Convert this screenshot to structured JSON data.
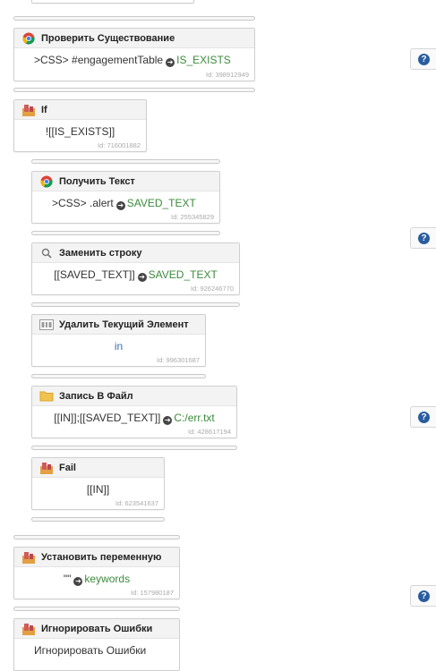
{
  "colors": {
    "accent_green": "#3c8a3c",
    "accent_blue": "#3b6fb6",
    "help_blue": "#2a5d9f"
  },
  "blocks": [
    {
      "title": "Проверить Существование",
      "icon": "chrome-icon",
      "selector": ">CSS> #engagementTable",
      "var": "IS_EXISTS",
      "id": "Id: 398912949"
    },
    {
      "title": "If",
      "icon": "condition-icon",
      "text": "![[IS_EXISTS]]",
      "id": "Id: 716001882"
    },
    {
      "title": "Получить Текст",
      "icon": "chrome-icon",
      "selector": ">CSS> .alert",
      "var": "SAVED_TEXT",
      "id": "Id: 255345829"
    },
    {
      "title": "Заменить строку",
      "icon": "search-icon",
      "selector": "[[SAVED_TEXT]]",
      "var": "SAVED_TEXT",
      "id": "Id: 926246770"
    },
    {
      "title": "Удалить Текущий Элемент",
      "icon": "list-icon",
      "text": "in",
      "id": "Id: 996301687"
    },
    {
      "title": "Запись В Файл",
      "icon": "folder-icon",
      "selector": "[[IN]];[[SAVED_TEXT]]",
      "var": "C:/err.txt",
      "id": "Id: 428617194"
    },
    {
      "title": "Fail",
      "icon": "condition-icon",
      "text": "[[IN]]",
      "id": "Id: 623541637"
    },
    {
      "title": "Установить переменную",
      "icon": "condition-icon",
      "selector": "\"\"",
      "var": "keywords",
      "id": "Id: 157980187"
    },
    {
      "title": "Игнорировать Ошибки",
      "icon": "condition-icon",
      "text": "Игнорировать Ошибки",
      "id": ""
    }
  ],
  "help_label": "?"
}
